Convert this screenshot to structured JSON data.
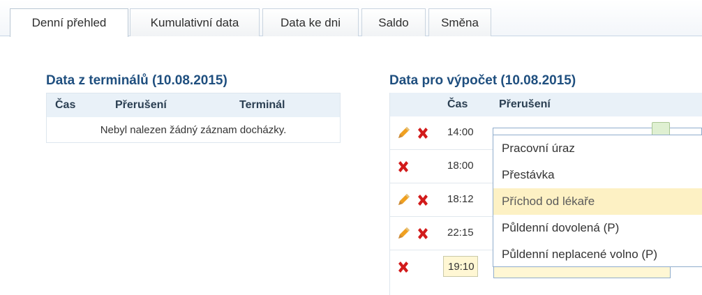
{
  "tabs": [
    {
      "label": "Denní přehled",
      "active": true
    },
    {
      "label": "Kumulativní data",
      "active": false
    },
    {
      "label": "Data ke dni",
      "active": false
    },
    {
      "label": "Saldo",
      "active": false
    },
    {
      "label": "Směna",
      "active": false
    }
  ],
  "terminal": {
    "title": "Data z terminálů (10.08.2015)",
    "columns": [
      "Čas",
      "Přerušení",
      "Terminál"
    ],
    "empty_message": "Nebyl nalezen žádný záznam docházky."
  },
  "calc": {
    "title": "Data pro výpočet (10.08.2015)",
    "columns": [
      "Čas",
      "Přerušení"
    ],
    "rows": [
      {
        "time": "14:00",
        "editable": true
      },
      {
        "time": "18:00",
        "editable": false
      },
      {
        "time": "18:12",
        "editable": true
      },
      {
        "time": "22:15",
        "editable": true
      }
    ],
    "new_row": {
      "time": "19:10",
      "reason": ""
    }
  },
  "dropdown": {
    "options": [
      "Pracovní úraz",
      "Přestávka",
      "Příchod od lékaře",
      "Půldenní dovolená (P)",
      "Půldenní neplacené volno (P)"
    ],
    "highlighted_option": "Příchod od lékaře"
  },
  "colors": {
    "accent_title": "#1f4f7f",
    "header_bg": "#e9f1f8",
    "input_bg": "#fff7d4",
    "highlight_bg": "#fdf1c4",
    "delete_red": "#d21b1b",
    "pencil_orange": "#f0a020"
  },
  "icons": {
    "edit": "pencil-icon",
    "delete": "delete-icon"
  }
}
